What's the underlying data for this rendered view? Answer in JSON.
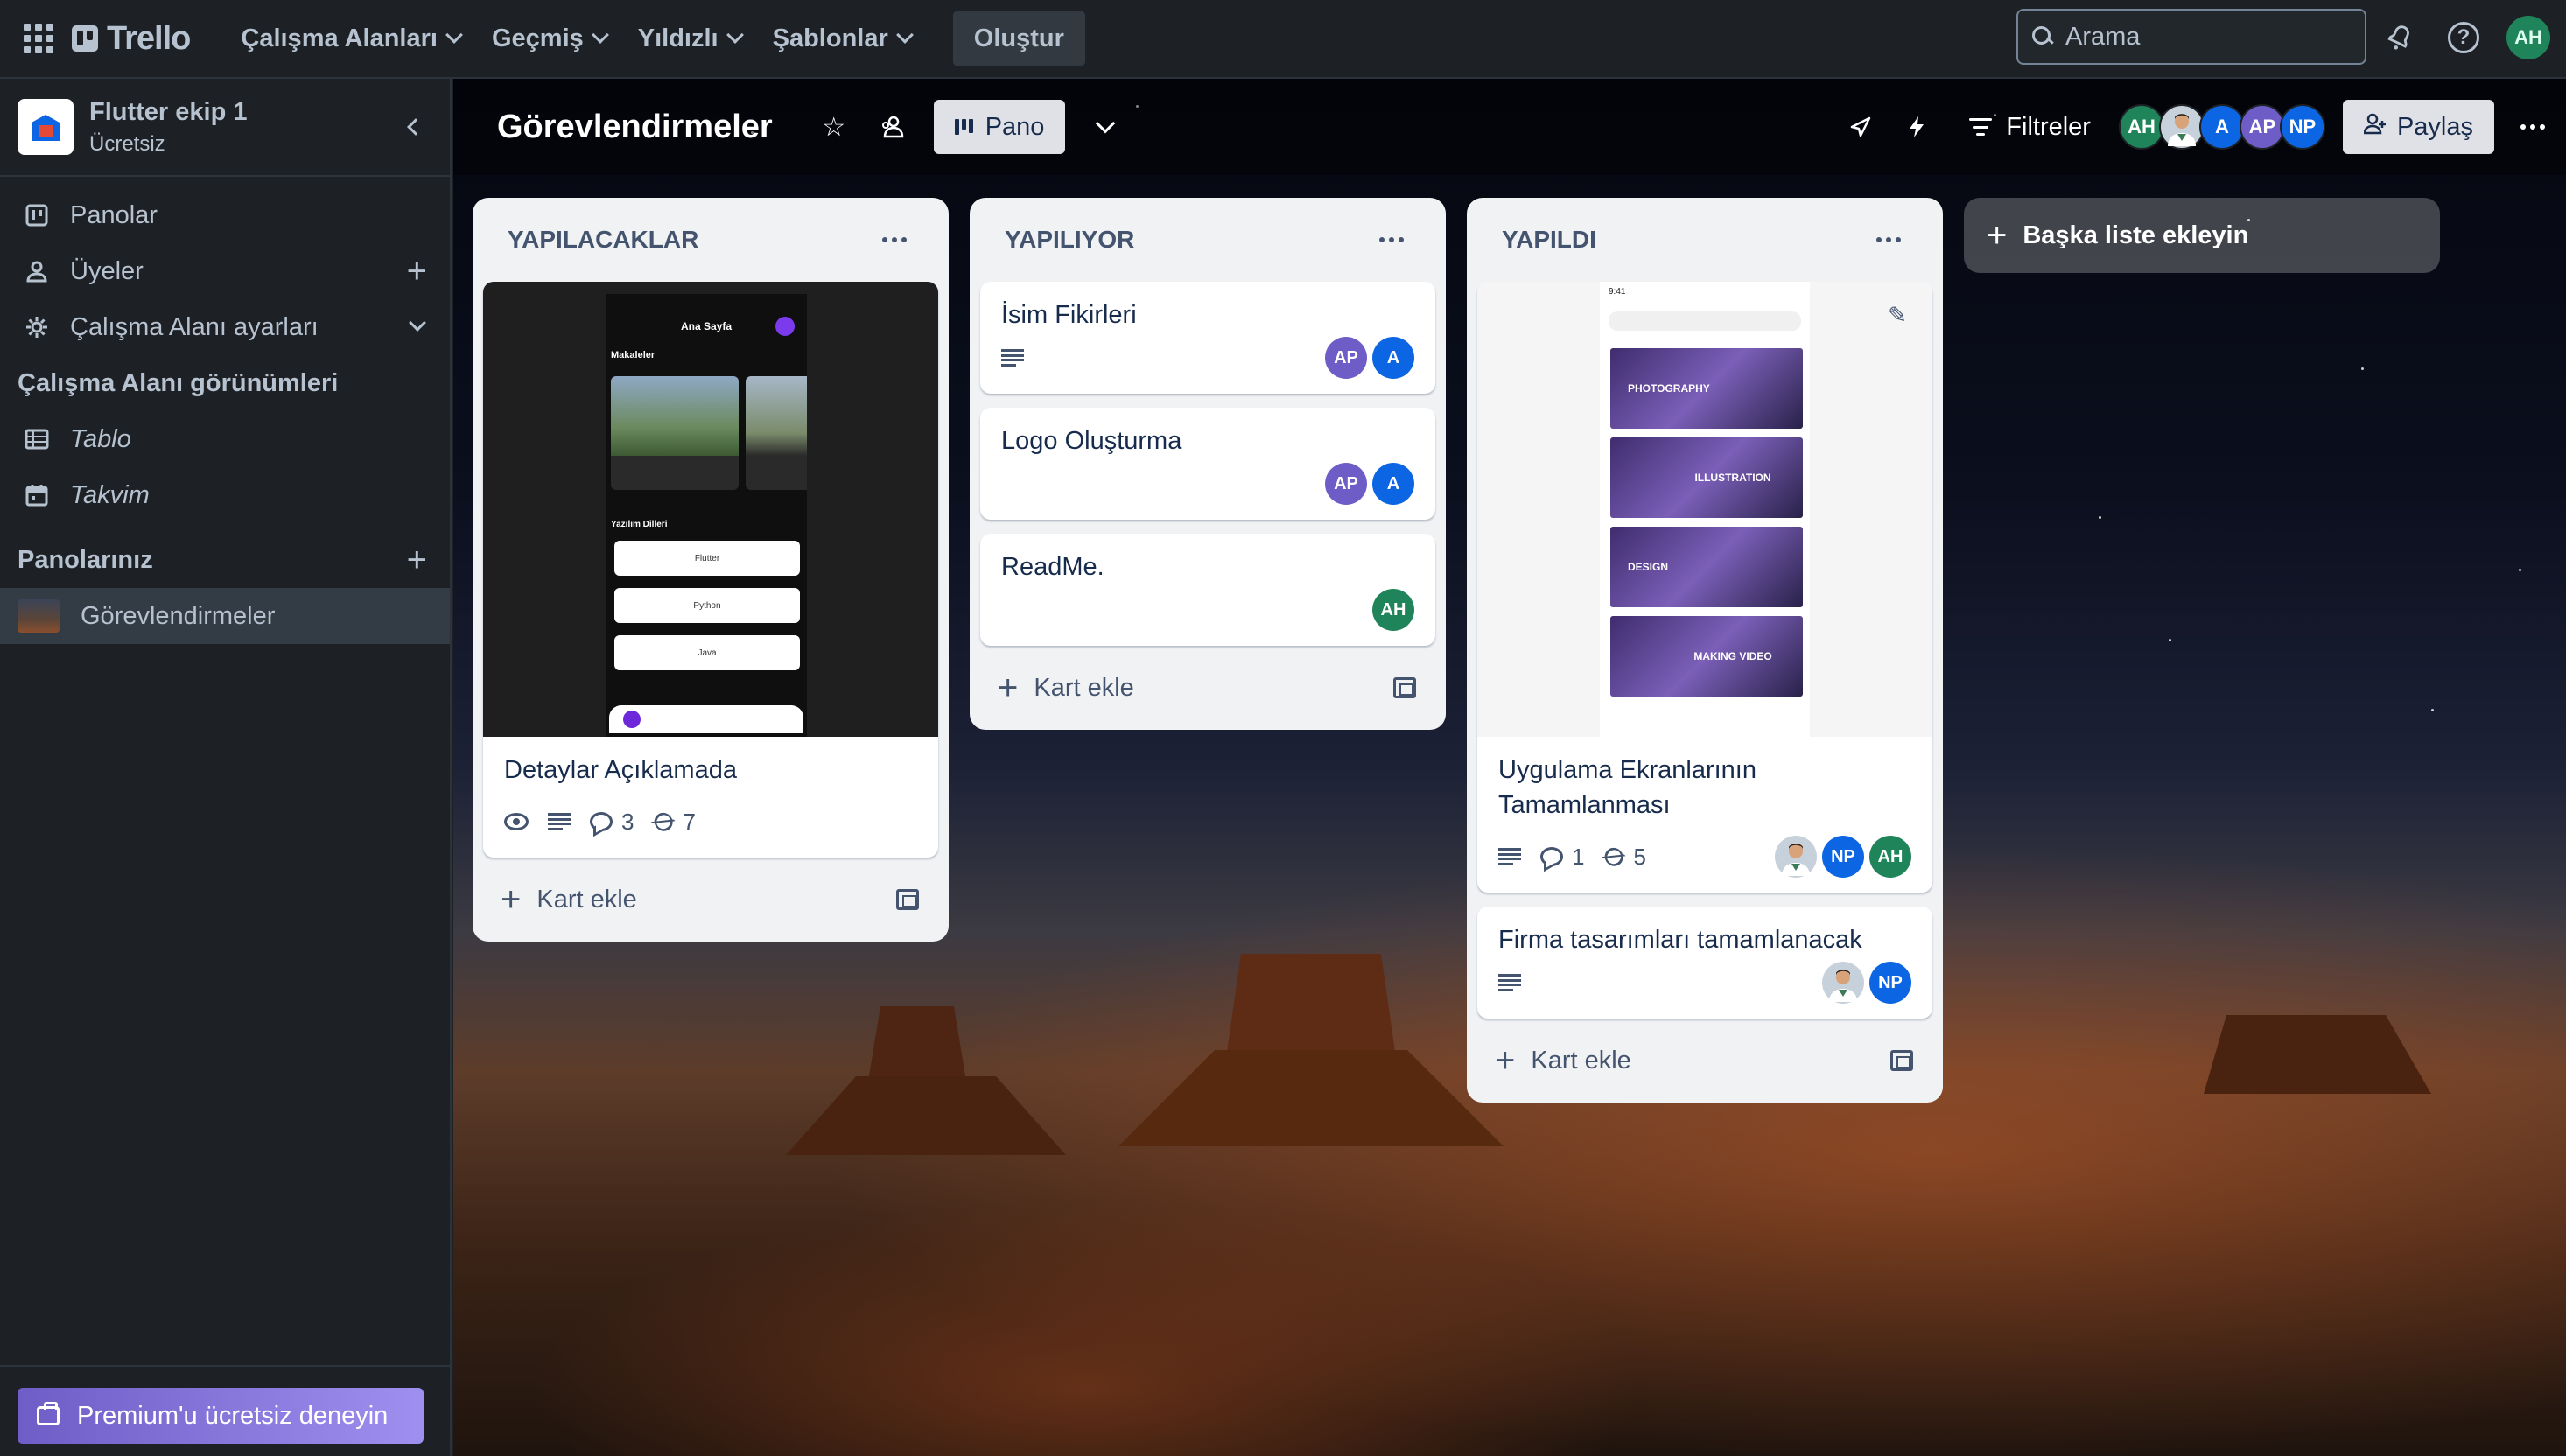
{
  "topnav": {
    "logo_text": "Trello",
    "menus": [
      "Çalışma Alanları",
      "Geçmiş",
      "Yıldızlı",
      "Şablonlar"
    ],
    "create_label": "Oluştur",
    "search_placeholder": "Arama",
    "user_initials": "AH"
  },
  "sidebar": {
    "workspace_name": "Flutter ekip 1",
    "workspace_plan": "Ücretsiz",
    "items": {
      "boards": "Panolar",
      "members": "Üyeler",
      "settings": "Çalışma Alanı ayarları"
    },
    "views_heading": "Çalışma Alanı görünümleri",
    "views": {
      "table": "Tablo",
      "calendar": "Takvim"
    },
    "your_boards_heading": "Panolarınız",
    "boards": [
      "Görevlendirmeler"
    ],
    "premium_label": "Premium'u ücretsiz deneyin"
  },
  "board": {
    "title": "Görevlendirmeler",
    "view_label": "Pano",
    "filter_label": "Filtreler",
    "share_label": "Paylaş",
    "members": [
      {
        "initials": "AH",
        "color": "#1f845a"
      },
      {
        "initials": "",
        "color": "#8590a2"
      },
      {
        "initials": "A",
        "color": "#0c66e4"
      },
      {
        "initials": "AP",
        "color": "#6e5dc6"
      },
      {
        "initials": "NP",
        "color": "#0c66e4"
      }
    ],
    "add_list_label": "Başka liste ekleyin",
    "add_card_label": "Kart ekle"
  },
  "lists": {
    "todo": {
      "title": "YAPILACAKLAR",
      "card1": {
        "title": "Detaylar Açıklamada",
        "comments": "3",
        "attachments": "7",
        "cover": {
          "header": "Ana Sayfa",
          "articles": "Makaleler",
          "languages_heading": "Yazılım Dilleri",
          "lang1": "Flutter",
          "lang2": "Python",
          "lang3": "Java"
        }
      }
    },
    "doing": {
      "title": "YAPILIYOR",
      "card1": {
        "title": "İsim Fikirleri",
        "m1": "AP",
        "m2": "A"
      },
      "card2": {
        "title": "Logo Oluşturma",
        "m1": "AP",
        "m2": "A"
      },
      "card3": {
        "title": "ReadMe.",
        "m1": "AH"
      }
    },
    "done": {
      "title": "YAPILDI",
      "card1": {
        "title": "Uygulama Ekranlarının Tamamlanması",
        "comments": "1",
        "attachments": "5",
        "m2": "NP",
        "m3": "AH",
        "cover": {
          "time": "9:41",
          "tile1": "PHOTOGRAPHY",
          "tile2": "ILLUSTRATION",
          "tile3": "DESIGN",
          "tile4": "MAKING VIDEO"
        }
      },
      "card2": {
        "title": "Firma tasarımları tamamlanacak",
        "m2": "NP"
      }
    }
  }
}
